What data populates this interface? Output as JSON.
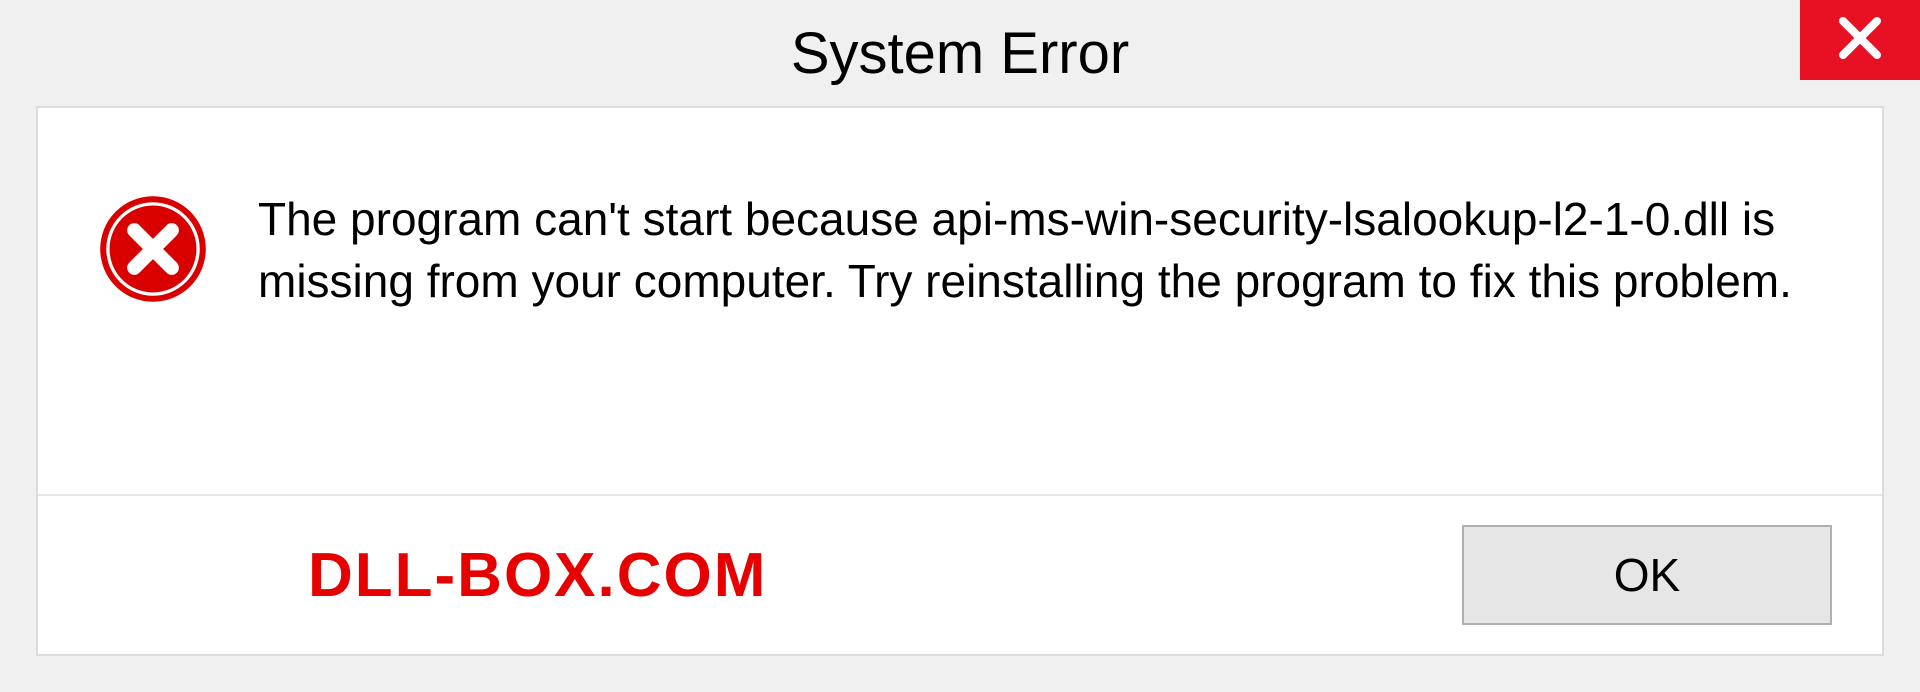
{
  "dialog": {
    "title": "System Error",
    "message": "The program can't start because api-ms-win-security-lsalookup-l2-1-0.dll is missing from your computer. Try reinstalling the program to fix this problem.",
    "ok_label": "OK",
    "watermark": "DLL-BOX.COM"
  },
  "colors": {
    "close_bg": "#e81123",
    "error_icon": "#d90000",
    "watermark": "#e60000"
  }
}
